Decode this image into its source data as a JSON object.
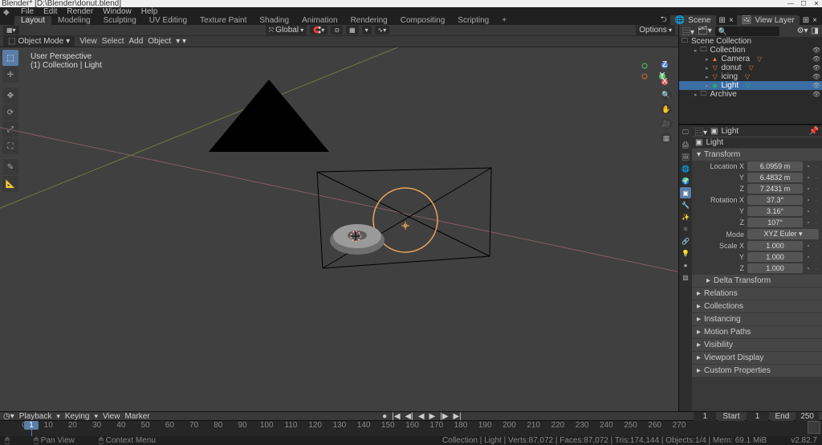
{
  "app": {
    "title": "Blender* [D:\\Blender\\donut.blend]",
    "version": "v2.82.7"
  },
  "menu": [
    "File",
    "Edit",
    "Render",
    "Window",
    "Help"
  ],
  "workspaces": {
    "items": [
      "Layout",
      "Modeling",
      "Sculpting",
      "UV Editing",
      "Texture Paint",
      "Shading",
      "Animation",
      "Rendering",
      "Compositing",
      "Scripting"
    ],
    "active": 0
  },
  "scene_bar": {
    "scene_label": "Scene",
    "viewlayer_label": "View Layer"
  },
  "viewport_header1": {
    "orient": "Global",
    "options": "Options"
  },
  "viewport_header2": {
    "mode": "Object Mode",
    "menus": [
      "View",
      "Select",
      "Add",
      "Object"
    ]
  },
  "viewport_info": {
    "line1": "User Perspective",
    "line2": "(1) Collection | Light"
  },
  "timeline": {
    "menus": [
      "Playback",
      "Keying",
      "View",
      "Marker"
    ],
    "current": "1",
    "start_label": "Start",
    "start": "1",
    "end_label": "End",
    "end": "250",
    "ticks": [
      "0",
      "10",
      "20",
      "30",
      "40",
      "50",
      "60",
      "70",
      "80",
      "90",
      "100",
      "110",
      "120",
      "130",
      "140",
      "150",
      "160",
      "170",
      "180",
      "190",
      "200",
      "210",
      "220",
      "230",
      "240",
      "250",
      "260",
      "270"
    ]
  },
  "status": {
    "hint1": "Pan View",
    "hint2": "Context Menu",
    "stats": "Collection | Light | Verts:87,072 | Faces:87,072 | Tris:174,144 | Objects:1/4 | Mem: 69.1 MiB"
  },
  "outliner": {
    "root": "Scene Collection",
    "items": [
      {
        "name": "Collection",
        "type": "collection",
        "indent": 14
      },
      {
        "name": "Camera",
        "type": "camera",
        "indent": 28
      },
      {
        "name": "donut",
        "type": "mesh",
        "indent": 28
      },
      {
        "name": "icing",
        "type": "mesh",
        "indent": 28
      },
      {
        "name": "Light",
        "type": "light",
        "indent": 28,
        "selected": true
      },
      {
        "name": "Archive",
        "type": "collection",
        "indent": 14
      }
    ]
  },
  "properties": {
    "context": "Light",
    "datablock": "Light",
    "panels": [
      {
        "title": "Transform",
        "open": true,
        "rows": [
          {
            "label": "Location X",
            "value": "6.0959 m"
          },
          {
            "label": "Y",
            "value": "6.4832 m"
          },
          {
            "label": "Z",
            "value": "7.2431 m"
          },
          {
            "label": "Rotation X",
            "value": "37.3°"
          },
          {
            "label": "Y",
            "value": "3.16°"
          },
          {
            "label": "Z",
            "value": "107°"
          },
          {
            "label": "Mode",
            "value": "XYZ Euler",
            "dropdown": true
          },
          {
            "label": "Scale X",
            "value": "1.000"
          },
          {
            "label": "Y",
            "value": "1.000"
          },
          {
            "label": "Z",
            "value": "1.000"
          }
        ]
      },
      {
        "title": "Delta Transform",
        "open": false,
        "sub": true
      },
      {
        "title": "Relations",
        "open": false
      },
      {
        "title": "Collections",
        "open": false
      },
      {
        "title": "Instancing",
        "open": false
      },
      {
        "title": "Motion Paths",
        "open": false
      },
      {
        "title": "Visibility",
        "open": false
      },
      {
        "title": "Viewport Display",
        "open": false
      },
      {
        "title": "Custom Properties",
        "open": false
      }
    ]
  }
}
